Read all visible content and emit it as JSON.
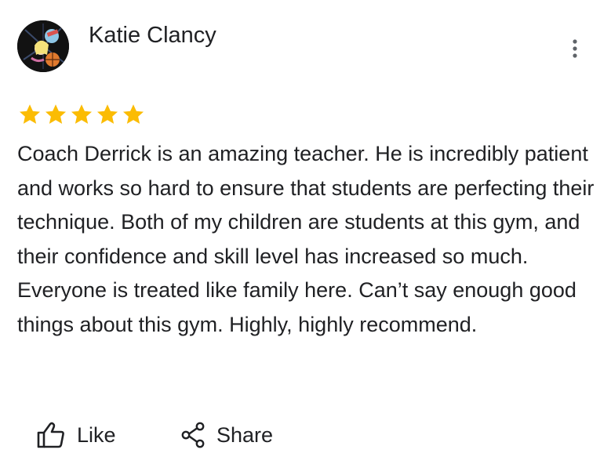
{
  "review": {
    "author": "Katie Clancy",
    "rating": 5,
    "rating_max": 5,
    "text": "Coach Derrick is an amazing teacher. He is incredibly patient and works so hard to ensure that students are perfecting their technique. Both of my children are students at this gym, and their confidence and skill level has increased so much. Everyone is treated like family here. Can’t say enough good things about this gym. Highly, highly recommend.",
    "star_color": "#fbbc04"
  },
  "actions": {
    "like_label": "Like",
    "share_label": "Share"
  },
  "icons": {
    "avatar": "avatar-illustration",
    "more": "more-vert-icon",
    "like": "thumb-up-icon",
    "share": "share-icon",
    "star": "star-icon"
  }
}
